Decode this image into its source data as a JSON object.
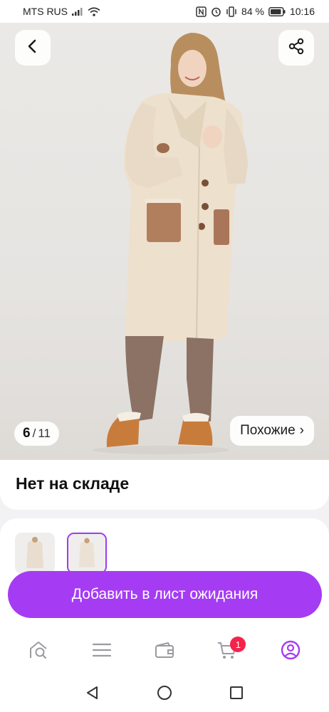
{
  "status_bar": {
    "carrier": "MTS RUS",
    "battery": "84 %",
    "time": "10:16"
  },
  "gallery": {
    "current": "6",
    "separator": "/",
    "total": "11",
    "similar_label": "Похожие",
    "similar_chevron": "›"
  },
  "product": {
    "stock_status": "Нет на складе"
  },
  "cta": {
    "label": "Добавить в лист ожидания"
  },
  "bottom_nav": {
    "cart_badge": "1",
    "items": [
      "home-icon",
      "menu-icon",
      "wallet-icon",
      "cart-icon",
      "profile-icon"
    ]
  },
  "colors": {
    "accent": "#a53cf3",
    "badge": "#f5234b"
  }
}
